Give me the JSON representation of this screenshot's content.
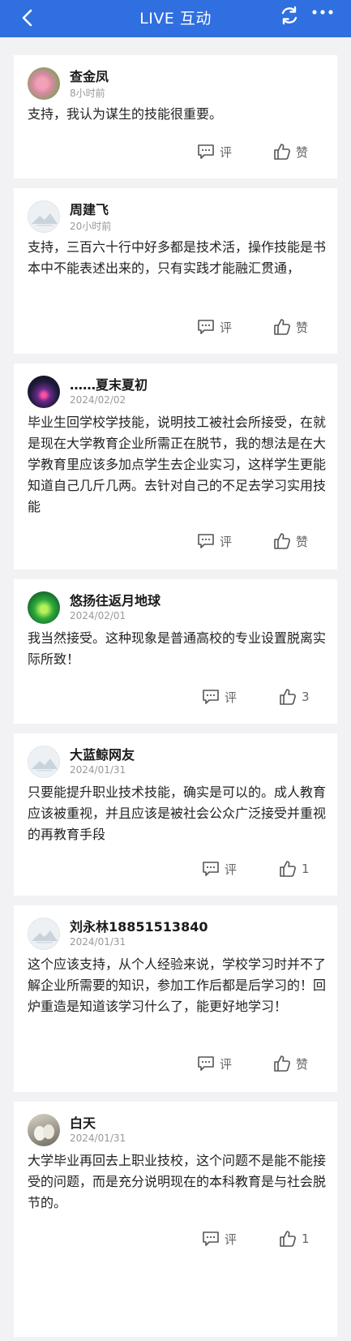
{
  "header": {
    "title": "LIVE 互动"
  },
  "colors": {
    "brand": "#2f6fe0",
    "background": "#f2f2f4"
  },
  "comments": [
    {
      "name": "查金凤",
      "time": "8小时前",
      "content": "支持，我认为谋生的技能很重要。",
      "comment_label": "评",
      "like_label": "赞",
      "avatar_icon": "pink-flower-avatar"
    },
    {
      "name": "周建飞",
      "time": "20小时前",
      "content": "支持，三百六十行中好多都是技术活，操作技能是书本中不能表述出来的，只有实践才能融汇贯通，",
      "comment_label": "评",
      "like_label": "赞",
      "avatar_icon": "default-mountain-avatar"
    },
    {
      "name": "……夏末夏初",
      "time": "2024/02/02",
      "content": "毕业生回学校学技能，说明技工被社会所接受，在就是现在大学教育企业所需正在脱节，我的想法是在大学教育里应该多加点学生去企业实习，这样学生更能知道自己几斤几两。去针对自己的不足去学习实用技能",
      "comment_label": "评",
      "like_label": "赞",
      "avatar_icon": "concert-stage-avatar"
    },
    {
      "name": "悠扬往返月地球",
      "time": "2024/02/01",
      "content": "我当然接受。这种现象是普通高校的专业设置脱离实际所致！",
      "comment_label": "评",
      "like_label": "3",
      "avatar_icon": "green-lotus-avatar"
    },
    {
      "name": "大蓝鲸网友",
      "time": "2024/01/31",
      "content": "只要能提升职业技术技能，确实是可以的。成人教育应该被重视，并且应该是被社会公众广泛接受并重视的再教育手段",
      "comment_label": "评",
      "like_label": "1",
      "avatar_icon": "default-mountain-avatar"
    },
    {
      "name": "刘永林18851513840",
      "time": "2024/01/31",
      "content": "这个应该支持，从个人经验来说，学校学习时并不了解企业所需要的知识，参加工作后都是后学习的！回炉重造是知道该学习什么了，能更好地学习！",
      "comment_label": "评",
      "like_label": "赞",
      "avatar_icon": "default-mountain-avatar"
    },
    {
      "name": "白天",
      "time": "2024/01/31",
      "content": "大学毕业再回去上职业技校，这个问题不是能不能接受的问题，而是充分说明现在的本科教育是与社会脱节的。",
      "comment_label": "评",
      "like_label": "1",
      "avatar_icon": "birds-avatar"
    }
  ]
}
